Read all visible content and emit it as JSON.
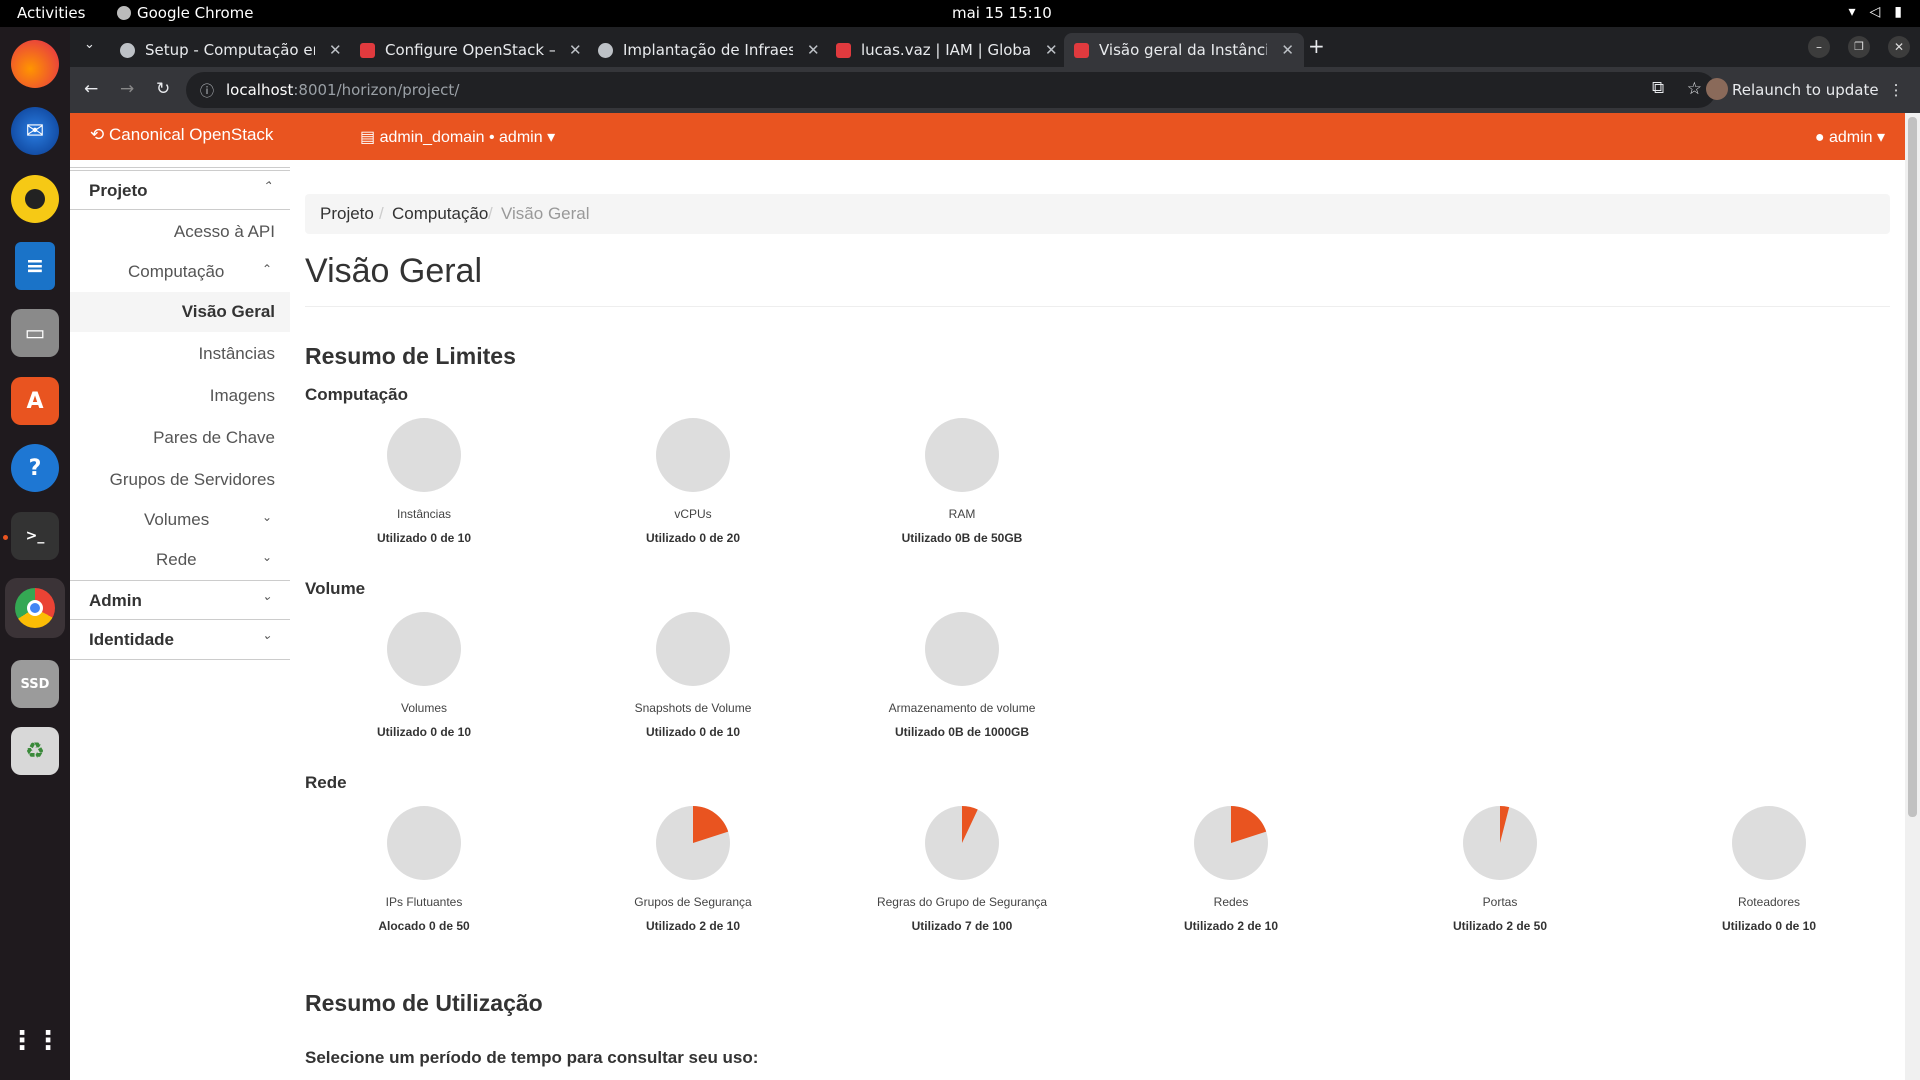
{
  "topbar": {
    "activities": "Activities",
    "app_name": "Google Chrome",
    "clock": "mai 15  15:10"
  },
  "dock": {
    "items": [
      "firefox-icon",
      "thunderbird-icon",
      "rhythmbox-icon",
      "writer-icon",
      "files-icon",
      "app-center-icon",
      "help-icon",
      "terminal-icon",
      "chrome-icon",
      "ssd-icon",
      "recycle-icon"
    ]
  },
  "browser": {
    "tabs": [
      {
        "label": "Setup - Computação em",
        "color": "#bdc1c6"
      },
      {
        "label": "Configure OpenStack —",
        "color": "#e03a3e"
      },
      {
        "label": "Implantação de Infraestr",
        "color": "#bdc1c6"
      },
      {
        "label": "lucas.vaz | IAM | Global",
        "color": "#e03a3e"
      },
      {
        "label": "Visão geral da Instância",
        "color": "#e03a3e"
      }
    ],
    "url_host": "localhost",
    "url_rest": ":8001/horizon/project/",
    "relaunch": "Relaunch to update"
  },
  "header": {
    "brand": "Canonical OpenStack",
    "project_selector": "admin_domain • admin",
    "user_menu": "admin"
  },
  "sidebar": {
    "projeto": "Projeto",
    "acesso_api": "Acesso à API",
    "computacao": "Computação",
    "visao_geral": "Visão Geral",
    "instancias": "Instâncias",
    "imagens": "Imagens",
    "pares_chave": "Pares de Chave",
    "grupos_servidores": "Grupos de Servidores",
    "volumes": "Volumes",
    "rede": "Rede",
    "admin": "Admin",
    "identidade": "Identidade"
  },
  "main": {
    "breadcrumb": [
      "Projeto",
      "Computação",
      "Visão Geral"
    ],
    "title": "Visão Geral",
    "limits_title": "Resumo de Limites",
    "groups": [
      {
        "name": "Computação",
        "charts": [
          {
            "label": "Instâncias",
            "usage": "Utilizado 0 de 10",
            "fraction": 0
          },
          {
            "label": "vCPUs",
            "usage": "Utilizado 0 de 20",
            "fraction": 0
          },
          {
            "label": "RAM",
            "usage": "Utilizado 0B de 50GB",
            "fraction": 0
          }
        ]
      },
      {
        "name": "Volume",
        "charts": [
          {
            "label": "Volumes",
            "usage": "Utilizado 0 de 10",
            "fraction": 0
          },
          {
            "label": "Snapshots de Volume",
            "usage": "Utilizado 0 de 10",
            "fraction": 0
          },
          {
            "label": "Armazenamento de volume",
            "usage": "Utilizado 0B de 1000GB",
            "fraction": 0
          }
        ]
      },
      {
        "name": "Rede",
        "charts": [
          {
            "label": "IPs Flutuantes",
            "usage": "Alocado 0 de 50",
            "fraction": 0
          },
          {
            "label": "Grupos de Segurança",
            "usage": "Utilizado 2 de 10",
            "fraction": 0.2
          },
          {
            "label": "Regras do Grupo de Segurança",
            "usage": "Utilizado 7 de 100",
            "fraction": 0.07
          },
          {
            "label": "Redes",
            "usage": "Utilizado 2 de 10",
            "fraction": 0.2
          },
          {
            "label": "Portas",
            "usage": "Utilizado 2 de 50",
            "fraction": 0.04
          },
          {
            "label": "Roteadores",
            "usage": "Utilizado 0 de 10",
            "fraction": 0
          }
        ]
      }
    ],
    "usage_title": "Resumo de Utilização",
    "period_prompt": "Selecione um período de tempo para consultar seu uso:"
  },
  "colors": {
    "accent": "#e95420",
    "pie_bg": "#dddddd"
  }
}
